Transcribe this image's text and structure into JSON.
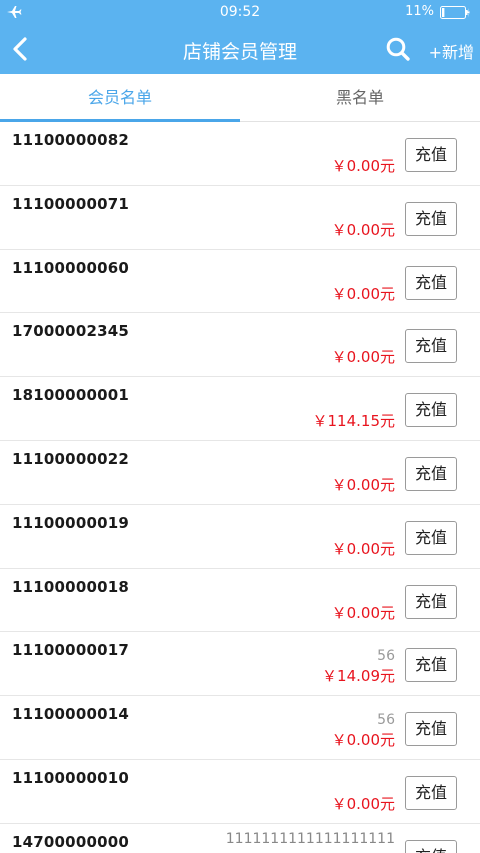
{
  "status_bar": {
    "time": "09:52",
    "battery_percent": "11%",
    "battery_level": 0.11
  },
  "nav": {
    "title": "店铺会员管理",
    "add_label": "+新增",
    "icons": [
      "back-arrow-icon",
      "search-icon"
    ]
  },
  "tabs": [
    {
      "label": "会员名单",
      "active": true
    },
    {
      "label": "黑名单",
      "active": false
    }
  ],
  "members": [
    {
      "phone": "11100000082",
      "note": "",
      "amount": "￥0.00元",
      "button": "充值"
    },
    {
      "phone": "11100000071",
      "note": "",
      "amount": "￥0.00元",
      "button": "充值"
    },
    {
      "phone": "11100000060",
      "note": "",
      "amount": "￥0.00元",
      "button": "充值"
    },
    {
      "phone": "17000002345",
      "note": "",
      "amount": "￥0.00元",
      "button": "充值"
    },
    {
      "phone": "18100000001",
      "note": "",
      "amount": "￥114.15元",
      "button": "充值"
    },
    {
      "phone": "11100000022",
      "note": "",
      "amount": "￥0.00元",
      "button": "充值"
    },
    {
      "phone": "11100000019",
      "note": "",
      "amount": "￥0.00元",
      "button": "充值"
    },
    {
      "phone": "11100000018",
      "note": "",
      "amount": "￥0.00元",
      "button": "充值"
    },
    {
      "phone": "11100000017",
      "note": "56",
      "amount": "￥14.09元",
      "button": "充值"
    },
    {
      "phone": "11100000014",
      "note": "56",
      "amount": "￥0.00元",
      "button": "充值"
    },
    {
      "phone": "11100000010",
      "note": "",
      "amount": "￥0.00元",
      "button": "充值"
    },
    {
      "phone": "14700000000",
      "note": "1111111111111111111",
      "amount": "",
      "button": "充值"
    }
  ],
  "colors": {
    "header": "#5bb3f0",
    "accent": "#4aa6e9",
    "amount": "#e8141e"
  }
}
